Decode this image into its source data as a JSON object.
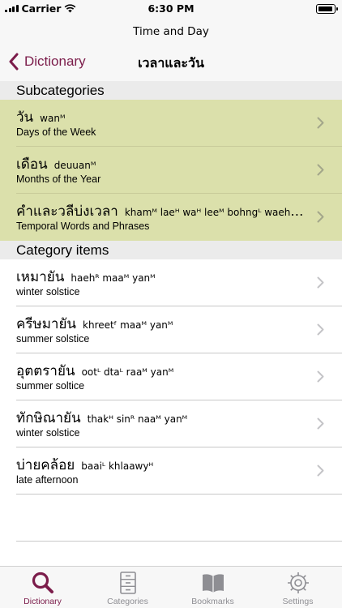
{
  "status": {
    "carrier": "Carrier",
    "time": "6:30 PM"
  },
  "nav": {
    "screen_title": "Time and Day",
    "back_label": "Dictionary",
    "thai_title": "เวลาและวัน"
  },
  "sections": {
    "subcategories": "Subcategories",
    "items": "Category items"
  },
  "subcategories": [
    {
      "thai": "วัน",
      "translit": "wanᴹ",
      "english": "Days of the Week"
    },
    {
      "thai": "เดือน",
      "translit": "deuuanᴹ",
      "english": "Months of the Year"
    },
    {
      "thai": "คำและวลีบ่งเวลา",
      "translit": "khamᴹ laeᴴ waᴴ leeᴹ bohngᴸ waehᴹ l...",
      "english": "Temporal Words and Phrases"
    }
  ],
  "items": [
    {
      "thai": "เหมายัน",
      "translit": "haehᴿ maaᴹ yanᴹ",
      "english": "winter solstice"
    },
    {
      "thai": "ครีษมายัน",
      "translit": "khreetᶠ maaᴹ yanᴹ",
      "english": "summer solstice"
    },
    {
      "thai": "อุตตรายัน",
      "translit": "ootᴸ dtaᴸ raaᴹ yanᴹ",
      "english": "summer soltice"
    },
    {
      "thai": "ทักษิณายัน",
      "translit": "thakᴴ sinᴿ naaᴹ yanᴹ",
      "english": "winter solstice"
    },
    {
      "thai": "บ่ายคล้อย",
      "translit": "baaiᴸ khlaawyᴴ",
      "english": "late afternoon"
    }
  ],
  "tabs": [
    {
      "label": "Dictionary",
      "icon": "search-icon",
      "active": true
    },
    {
      "label": "Categories",
      "icon": "cabinet-icon",
      "active": false
    },
    {
      "label": "Bookmarks",
      "icon": "book-icon",
      "active": false
    },
    {
      "label": "Settings",
      "icon": "gear-icon",
      "active": false
    }
  ],
  "colors": {
    "accent": "#7b1c4a",
    "subcategory_bg": "#dbe0ab",
    "section_bg": "#ebebeb",
    "inactive_tab": "#8e8e93"
  }
}
